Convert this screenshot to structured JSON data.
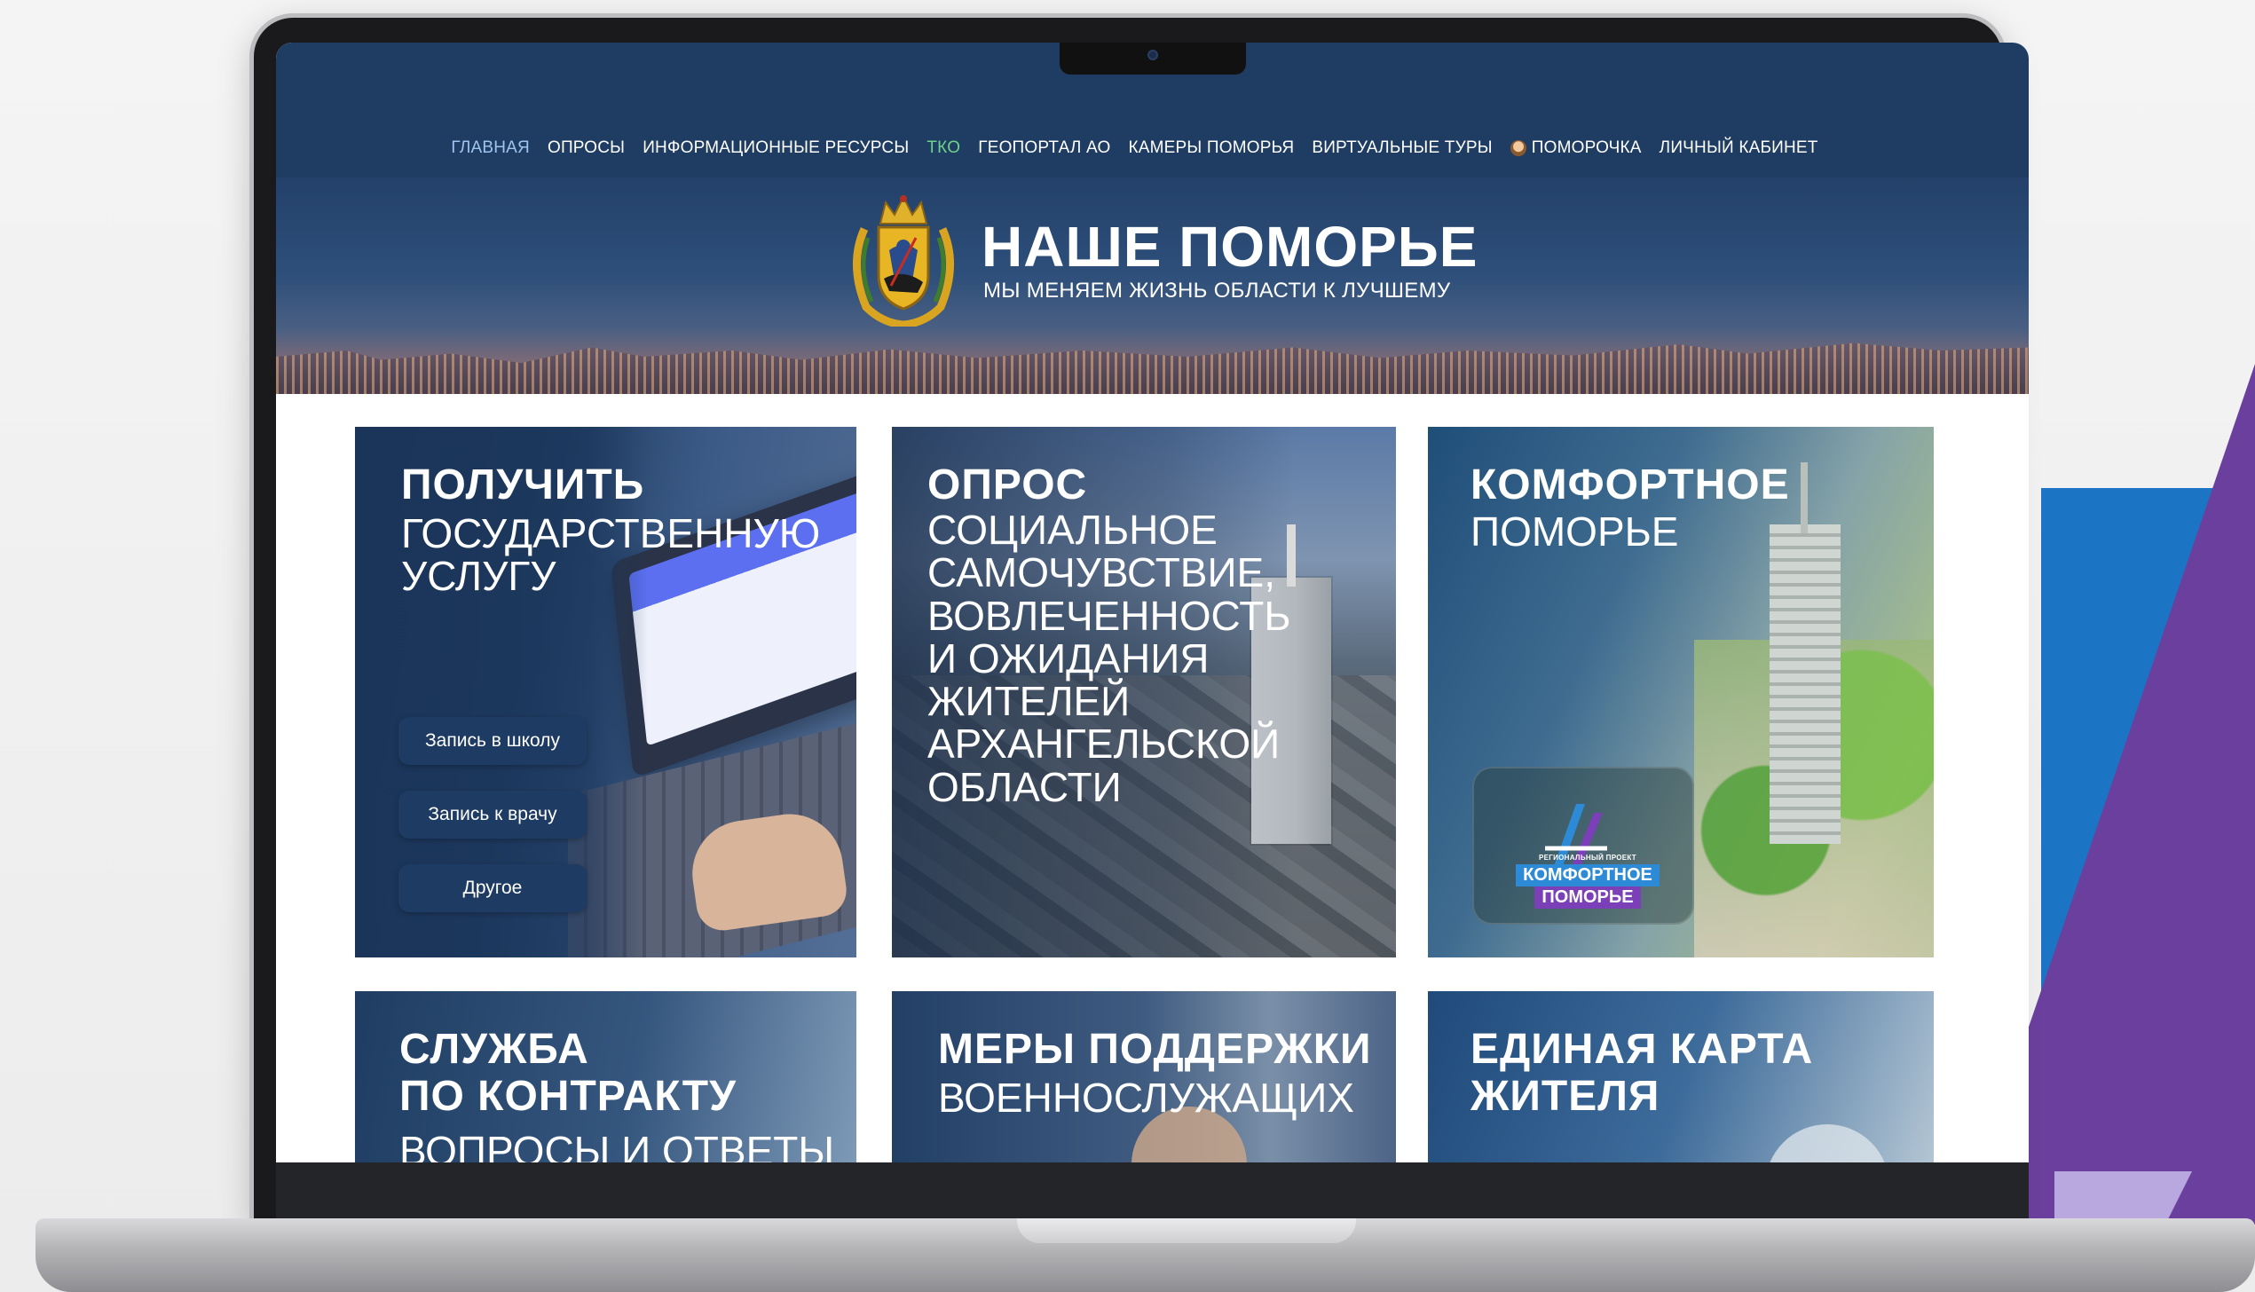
{
  "nav": {
    "items": [
      {
        "label": "ГЛАВНАЯ",
        "state": "active"
      },
      {
        "label": "ОПРОСЫ"
      },
      {
        "label": "ИНФОРМАЦИОННЫЕ РЕСУРСЫ"
      },
      {
        "label": "ТКО",
        "color": "#6fd28a"
      },
      {
        "label": "ГЕОПОРТАЛ АО"
      },
      {
        "label": "КАМЕРЫ ПОМОРЬЯ"
      },
      {
        "label": "ВИРТУАЛЬНЫЕ ТУРЫ"
      },
      {
        "label": "ПОМОРОЧКА",
        "icon": "avatar-icon"
      },
      {
        "label": "ЛИЧНЫЙ КАБИНЕТ"
      }
    ]
  },
  "header": {
    "title": "НАШЕ ПОМОРЬЕ",
    "subtitle": "МЫ МЕНЯЕМ ЖИЗНЬ ОБЛАСТИ К ЛУЧШЕМУ",
    "logo": "coat-of-arms-icon"
  },
  "tiles": {
    "gosuslugi": {
      "title": "ПОЛУЧИТЬ",
      "subtitle": "ГОСУДАРСТВЕННУЮ\nУСЛУГУ",
      "buttons": [
        "Запись в школу",
        "Запись к врачу",
        "Другое"
      ]
    },
    "survey": {
      "title": "ОПРОС",
      "subtitle": "СОЦИАЛЬНОЕ\nСАМОЧУВСТВИЕ,\nВОВЛЕЧЕННОСТЬ\nИ ОЖИДАНИЯ\nЖИТЕЛЕЙ\nАРХАНГЕЛЬСКОЙ\nОБЛАСТИ"
    },
    "comfort": {
      "title": "КОМФОРТНОЕ",
      "subtitle": "ПОМОРЬЕ",
      "badge_small": "РЕГИОНАЛЬНЫЙ ПРОЕКТ",
      "badge_line1": "КОМФОРТНОЕ",
      "badge_line2": "ПОМОРЬЕ"
    },
    "contract": {
      "title": "СЛУЖБА\nПО КОНТРАКТУ",
      "subtitle": "ВОПРОСЫ И ОТВЕТЫ"
    },
    "support": {
      "title": "МЕРЫ ПОДДЕРЖКИ",
      "subtitle": "ВОЕННОСЛУЖАЩИХ"
    },
    "card": {
      "title": "ЕДИНАЯ КАРТА\nЖИТЕЛЯ"
    }
  },
  "colors": {
    "nav_bg": "#1f3d62",
    "active_nav": "#9fc4ef",
    "tko_green": "#6fd28a",
    "button_bg": "#1e3b63",
    "accent_blue": "#1b74c4",
    "accent_purple": "#6b3f9d"
  }
}
